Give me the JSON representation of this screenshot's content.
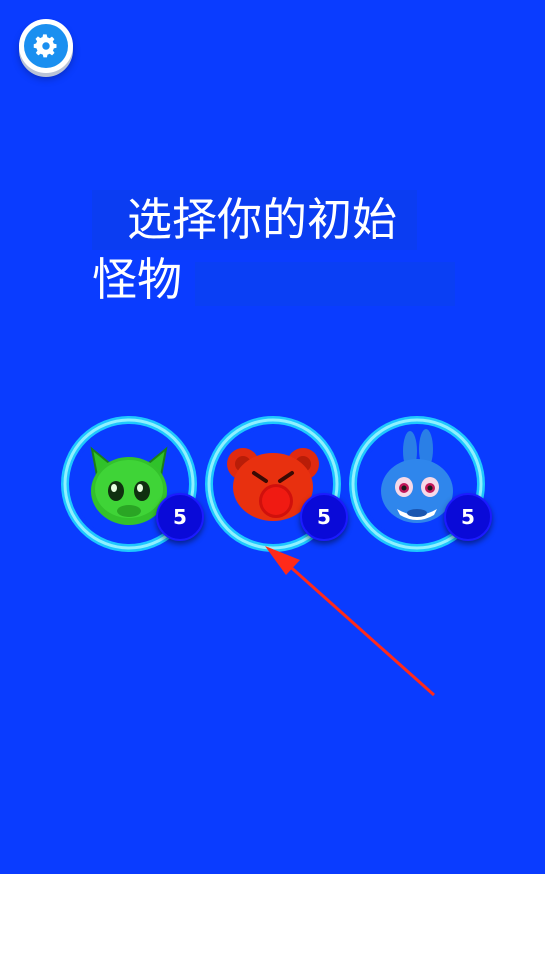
{
  "header": {
    "settings_icon": "gear-icon"
  },
  "title": {
    "line1": "选择你的初始",
    "line2": "怪物"
  },
  "monsters": [
    {
      "name": "green-cat-monster",
      "level": "5"
    },
    {
      "name": "red-bear-monster",
      "level": "5"
    },
    {
      "name": "blue-bunny-monster",
      "level": "5"
    }
  ],
  "colors": {
    "background": "#0a3cff",
    "ring": "#2fd3ff",
    "badge": "#0a0ad8",
    "arrow": "#ff2a1a"
  }
}
